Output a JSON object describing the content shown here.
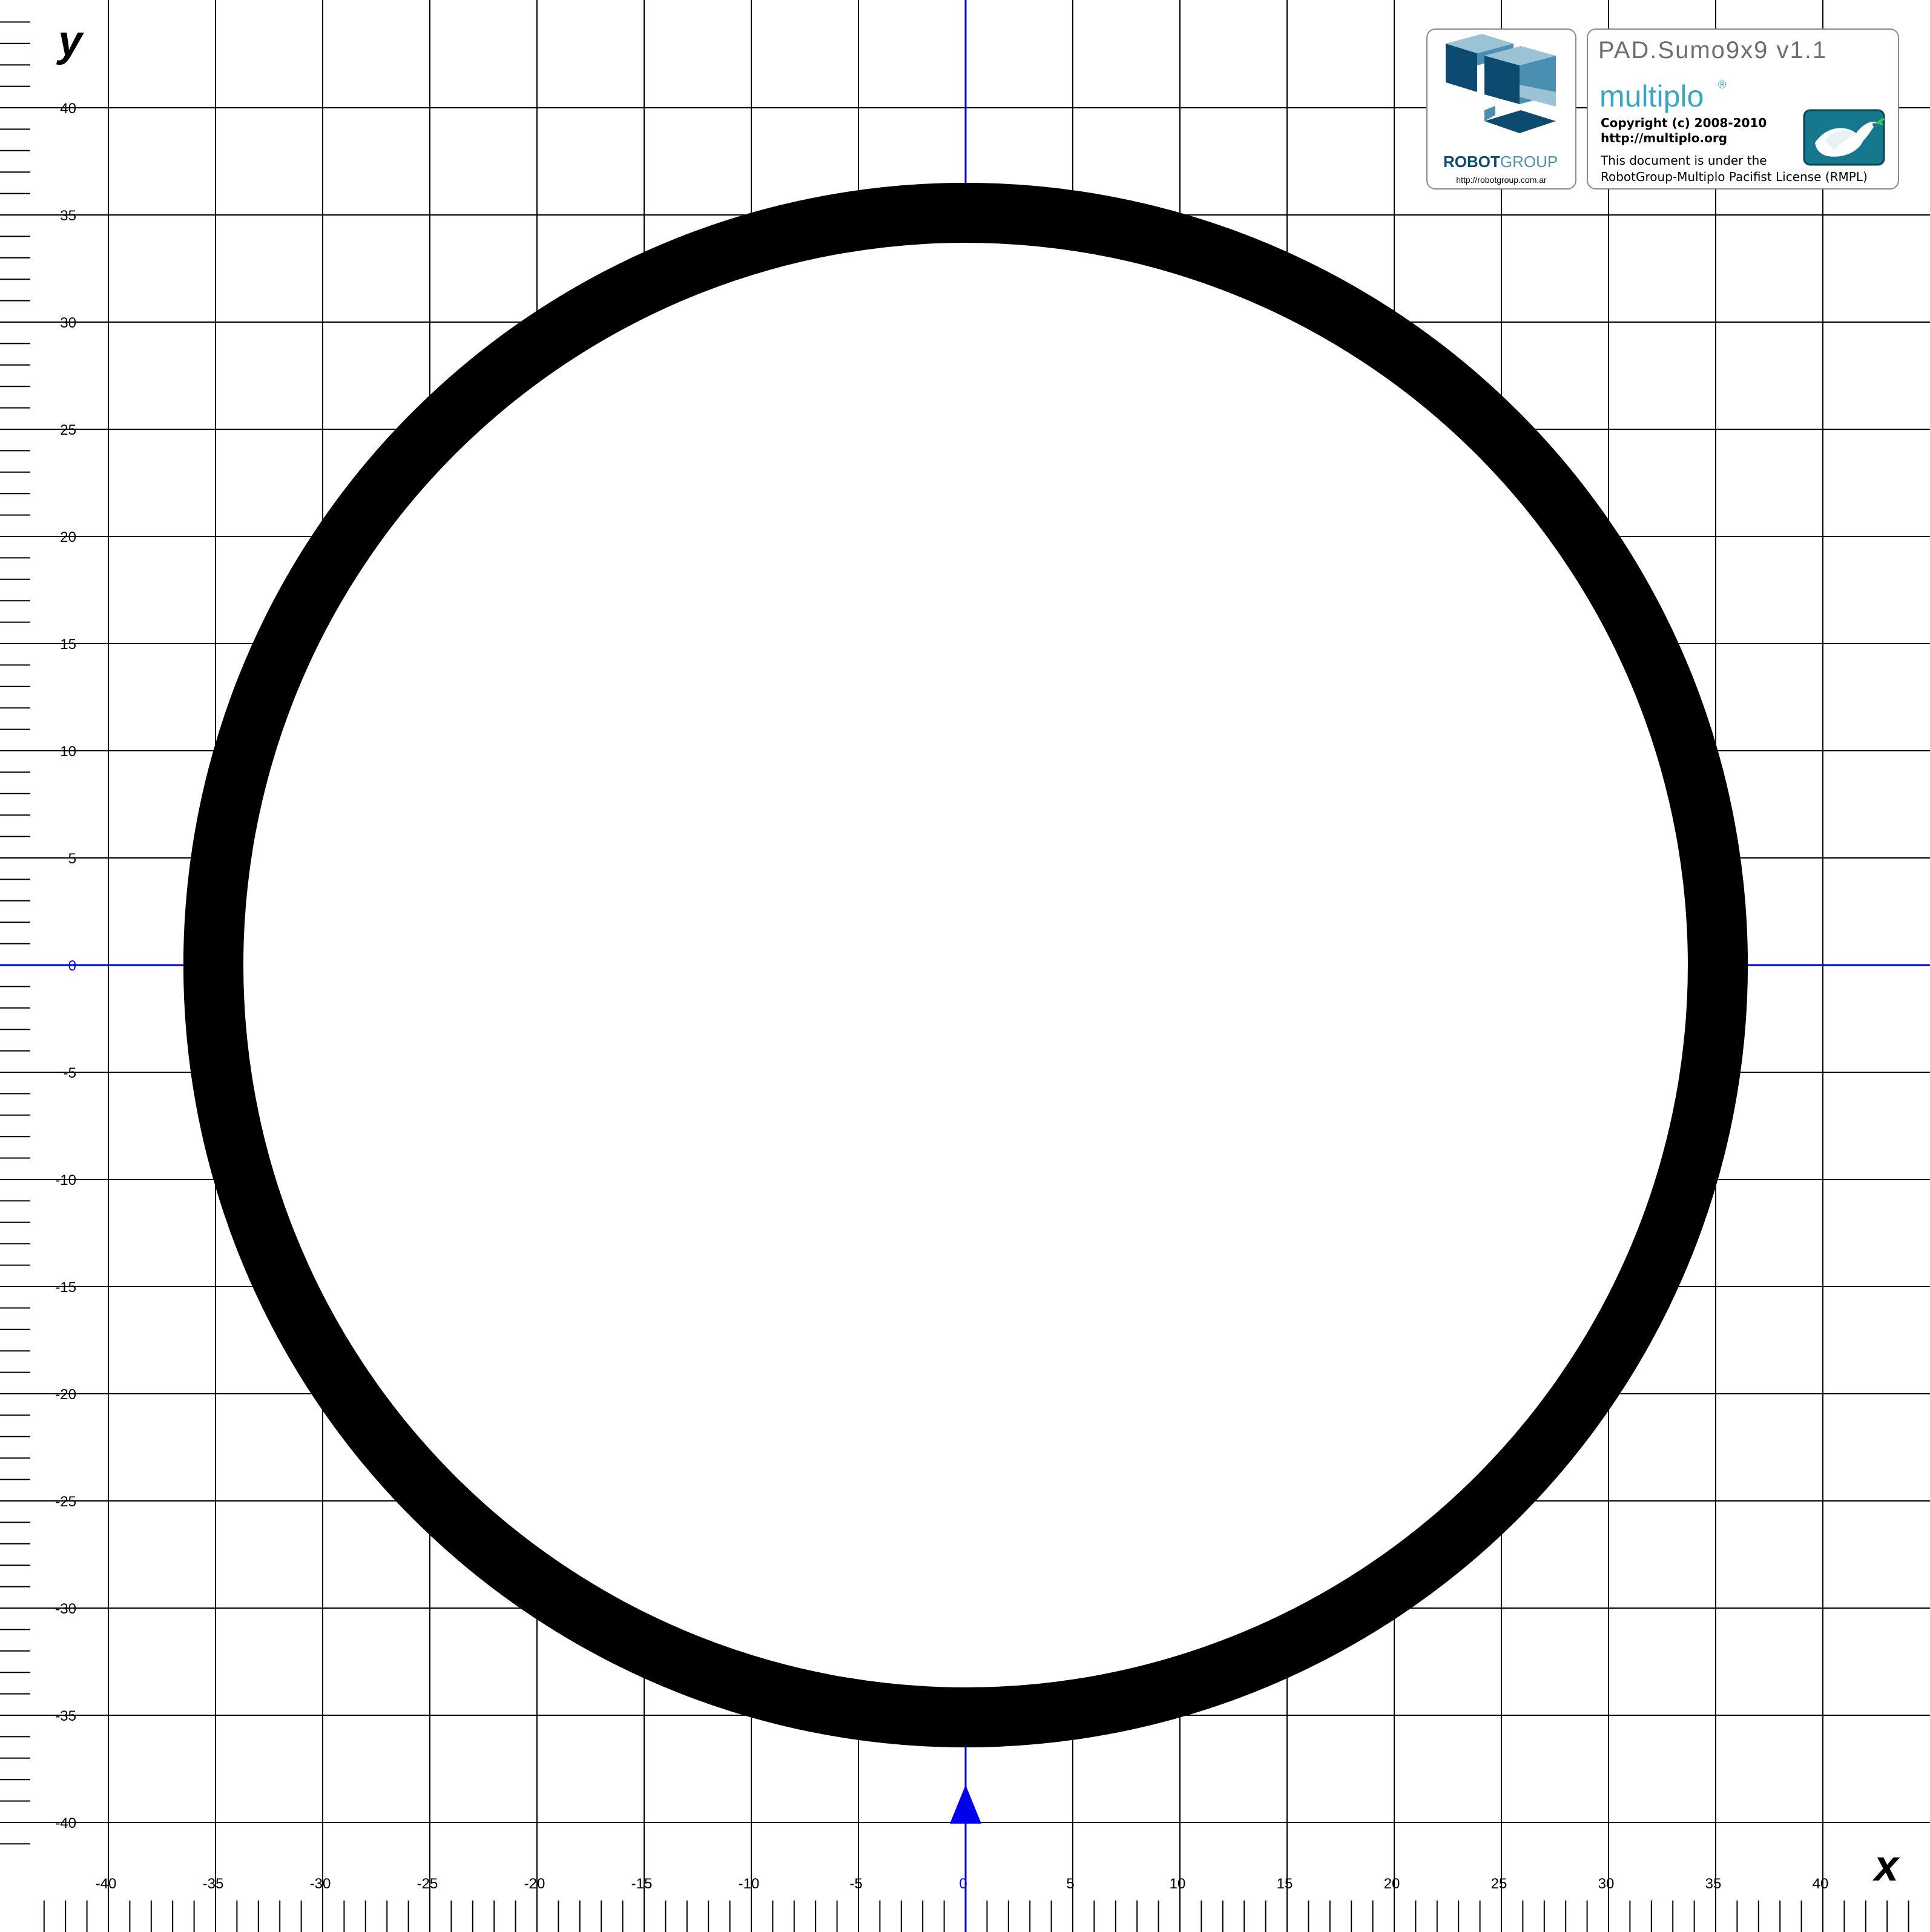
{
  "axes": {
    "x_label": "x",
    "y_label": "y",
    "x_ticks": [
      -40,
      -35,
      -30,
      -25,
      -20,
      -15,
      -10,
      -5,
      0,
      5,
      10,
      15,
      20,
      25,
      30,
      35,
      40
    ],
    "y_ticks": [
      40,
      35,
      30,
      25,
      20,
      15,
      10,
      5,
      0,
      -5,
      -10,
      -15,
      -20,
      -25,
      -30,
      -35,
      -40
    ],
    "range": [
      -45,
      45
    ],
    "minor_tick_step": 1
  },
  "ring": {
    "center": [
      0,
      0
    ],
    "outer_radius": 36.5,
    "inner_radius": 33.7,
    "color": "#000000"
  },
  "start_marker": {
    "position": [
      0,
      -40
    ],
    "color": "#0000ee"
  },
  "colors": {
    "grid": "#000000",
    "axis": "#0000ee",
    "robotgroup_dark": "#0d4a70",
    "robotgroup_light": "#4a8fb2",
    "multiplo": "#3aa6c4",
    "dove_bg": "#16788c"
  },
  "robotgroup_card": {
    "logo_icon": "robotgroup-cubes-logo",
    "name_bold": "ROBOT",
    "name_light": "GROUP",
    "url": "http://robotgroup.com.ar"
  },
  "multiplo_card": {
    "title": "PAD.Sumo9x9 v1.1",
    "brand": "multiplo",
    "brand_mark": "®",
    "copyright": "Copyright (c) 2008-2010",
    "website": "http://multiplo.org",
    "license_line1": "This document is under the",
    "license_line2": "RobotGroup-Multiplo Pacifist License (RMPL)",
    "icon": "peace-dove-icon"
  }
}
